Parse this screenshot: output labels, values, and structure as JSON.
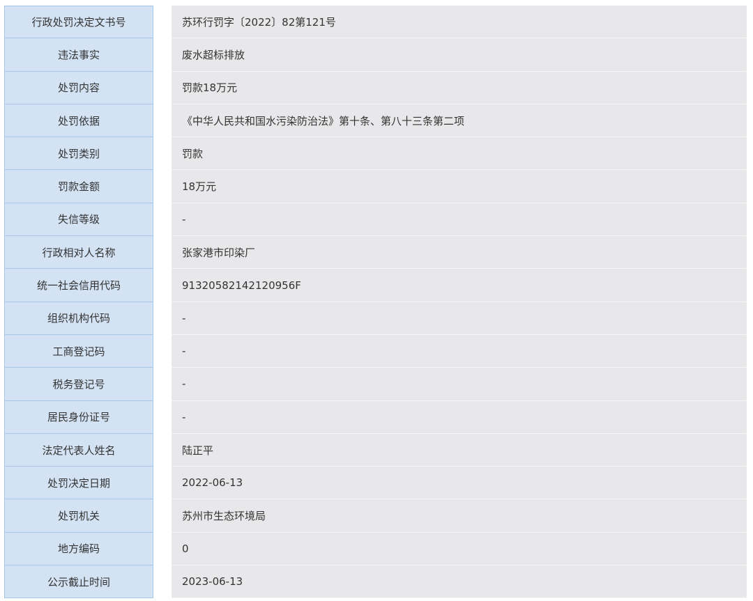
{
  "rows": [
    {
      "label": "行政处罚决定文书号",
      "value": "苏环行罚字〔2022〕82第121号"
    },
    {
      "label": "违法事实",
      "value": "废水超标排放"
    },
    {
      "label": "处罚内容",
      "value": "罚款18万元"
    },
    {
      "label": "处罚依据",
      "value": "《中华人民共和国水污染防治法》第十条、第八十三条第二项"
    },
    {
      "label": "处罚类别",
      "value": "罚款"
    },
    {
      "label": "罚款金额",
      "value": "18万元"
    },
    {
      "label": "失信等级",
      "value": "-"
    },
    {
      "label": "行政相对人名称",
      "value": "张家港市印染厂"
    },
    {
      "label": "统一社会信用代码",
      "value": "91320582142120956F"
    },
    {
      "label": "组织机构代码",
      "value": "-"
    },
    {
      "label": "工商登记码",
      "value": "-"
    },
    {
      "label": "税务登记号",
      "value": "-"
    },
    {
      "label": "居民身份证号",
      "value": "-"
    },
    {
      "label": "法定代表人姓名",
      "value": "陆正平"
    },
    {
      "label": "处罚决定日期",
      "value": "2022-06-13"
    },
    {
      "label": "处罚机关",
      "value": "苏州市生态环境局"
    },
    {
      "label": "地方编码",
      "value": "0"
    },
    {
      "label": "公示截止时间",
      "value": "2023-06-13"
    }
  ]
}
